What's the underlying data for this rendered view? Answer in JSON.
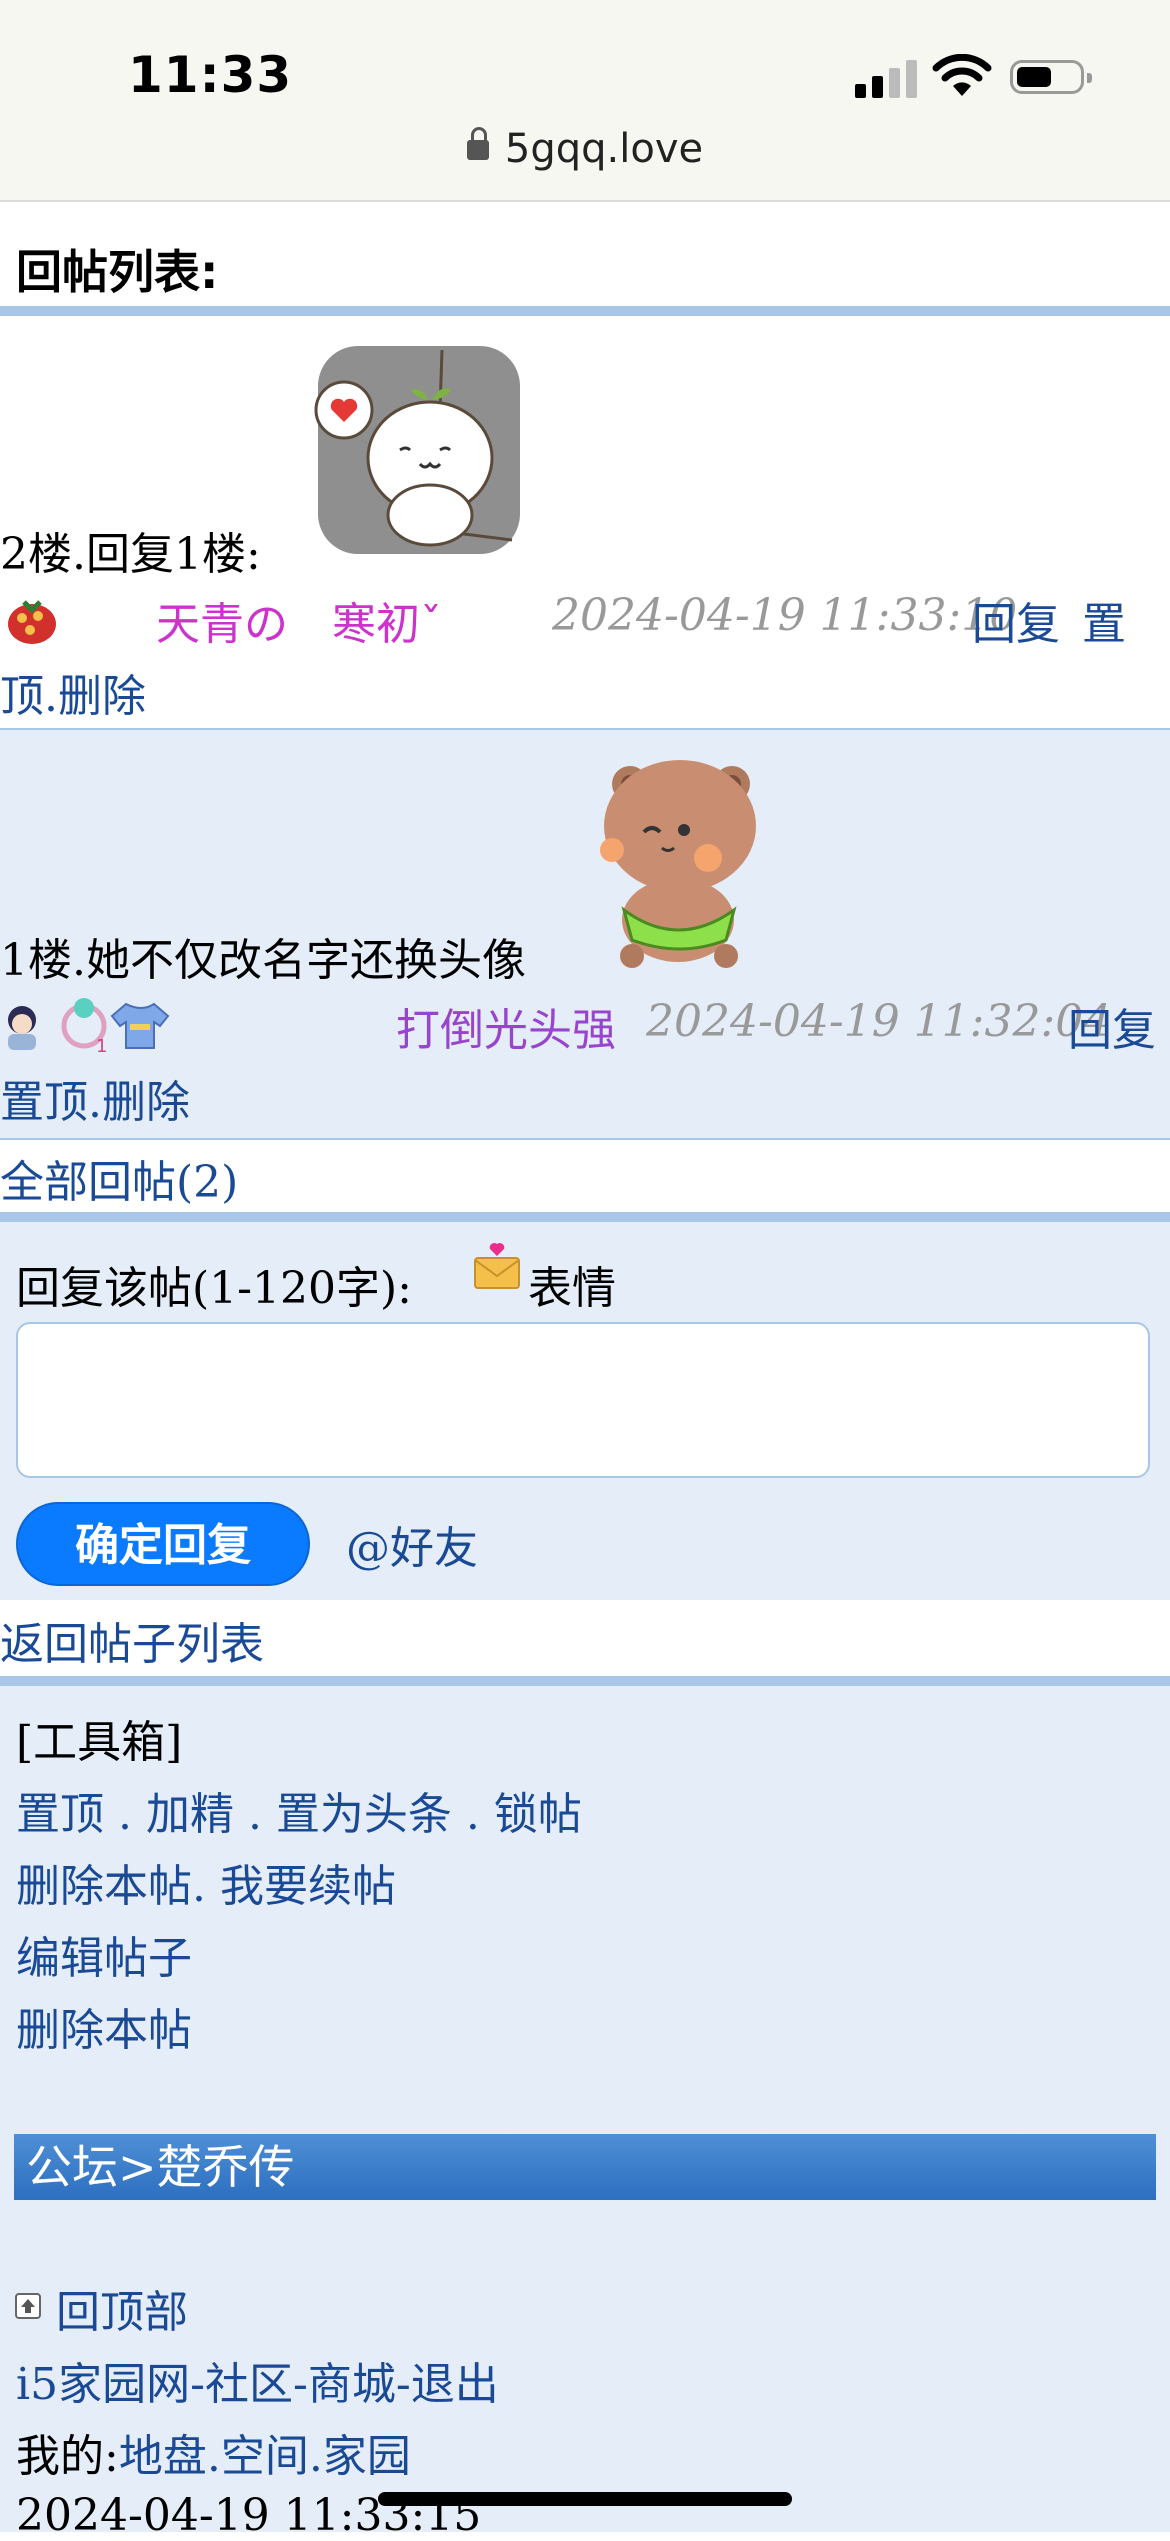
{
  "status_bar": {
    "time": "11:33",
    "url": "5gqq.love"
  },
  "page_title": "回帖列表:",
  "posts": [
    {
      "floor": "2楼.回复1楼:",
      "user": "天青の　寒初ˇ",
      "time": "2024-04-19 11:33:10",
      "reply": "回复",
      "pin_a": "置",
      "pin_b": "顶",
      "delete": ".删除"
    },
    {
      "floor": "1楼.她不仅改名字还换头像",
      "user": "打倒光头强",
      "time": "2024-04-19 11:32:04",
      "reply": "回复",
      "pin": "置顶",
      "delete": ".删除"
    }
  ],
  "all_replies": "全部回帖(2)",
  "reply_form": {
    "label": "回复该帖(1-120字):",
    "emoji_label": "表情",
    "submit": "确定回复",
    "at_friend": "@好友"
  },
  "back_to_list": "返回帖子列表",
  "toolbox": {
    "title": "[工具箱]",
    "row1": [
      "置顶",
      " . ",
      "加精",
      " . ",
      "置为头条",
      " . ",
      "锁帖"
    ],
    "row2": [
      "删除本帖",
      ". ",
      "我要续帖"
    ],
    "row3": "编辑帖子",
    "row4": "删除本帖"
  },
  "breadcrumb": {
    "forum": "公坛",
    "sep": ">",
    "board": "楚乔传"
  },
  "footer": {
    "back_top": "回顶部",
    "links": [
      "i5家园网",
      "-",
      "社区",
      "-",
      "商城",
      "-",
      "退出"
    ],
    "mine_label": "我的:",
    "mine_links": [
      "地盘",
      ".",
      "空间",
      ".",
      "家园"
    ],
    "datetime": "2024-04-19 11:33:15"
  },
  "colors": {
    "link": "#1a4a96",
    "accent": "#0a7bff",
    "divider": "#a8c6e6",
    "panel": "#e4edf8"
  }
}
